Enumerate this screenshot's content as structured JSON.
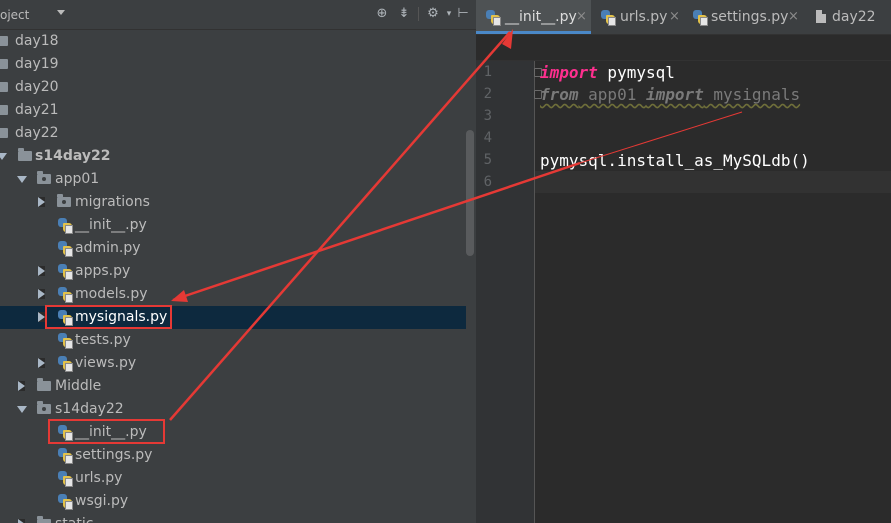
{
  "project_panel": {
    "title": "oject",
    "toolbar_icons": [
      "crosshair-icon",
      "collapse-icon",
      "gear-icon",
      "hide-icon"
    ],
    "tree": [
      {
        "label": "day18",
        "type": "folder"
      },
      {
        "label": "day19",
        "type": "folder"
      },
      {
        "label": "day20",
        "type": "folder"
      },
      {
        "label": "day21",
        "type": "folder"
      },
      {
        "label": "day22",
        "type": "folder"
      },
      {
        "label": "s14day22",
        "type": "folder",
        "expanded": true,
        "bold": true
      },
      {
        "label": "app01",
        "type": "folder",
        "expanded": true
      },
      {
        "label": "migrations",
        "type": "folder",
        "collapsed": true
      },
      {
        "label": "__init__.py",
        "type": "python-file"
      },
      {
        "label": "admin.py",
        "type": "python-file"
      },
      {
        "label": "apps.py",
        "type": "python-file",
        "collapsed": true
      },
      {
        "label": "models.py",
        "type": "python-file",
        "collapsed": true
      },
      {
        "label": "mysignals.py",
        "type": "python-file",
        "collapsed": true,
        "selected": true,
        "highlighted": true
      },
      {
        "label": "tests.py",
        "type": "python-file"
      },
      {
        "label": "views.py",
        "type": "python-file",
        "collapsed": true
      },
      {
        "label": "Middle",
        "type": "folder",
        "collapsed": true
      },
      {
        "label": "s14day22",
        "type": "folder",
        "expanded": true
      },
      {
        "label": "__init__.py",
        "type": "python-file",
        "highlighted": true
      },
      {
        "label": "settings.py",
        "type": "python-file"
      },
      {
        "label": "urls.py",
        "type": "python-file"
      },
      {
        "label": "wsgi.py",
        "type": "python-file"
      },
      {
        "label": "static",
        "type": "folder",
        "collapsed": true
      }
    ]
  },
  "editor": {
    "tabs": [
      {
        "label": "__init__.py",
        "active": true,
        "icon": "python-file-icon"
      },
      {
        "label": "urls.py",
        "active": false,
        "icon": "python-file-icon"
      },
      {
        "label": "settings.py",
        "active": false,
        "icon": "python-file-icon"
      },
      {
        "label": "day22",
        "active": false,
        "icon": "document-icon"
      }
    ],
    "close_glyph": "×",
    "line_numbers": [
      "1",
      "2",
      "3",
      "4",
      "5",
      "6"
    ],
    "code": {
      "l1_kw": "import",
      "l1_rest": " pymysql",
      "l2_kw1": "from",
      "l2_mod": " app01 ",
      "l2_kw2": "import",
      "l2_name": " mysignals",
      "l5": "pymysql.install_as_MySQLdb()"
    }
  },
  "colors": {
    "annotation_red": "#e53935",
    "keyword": "#ff2f8f",
    "selection": "#0d293e"
  }
}
